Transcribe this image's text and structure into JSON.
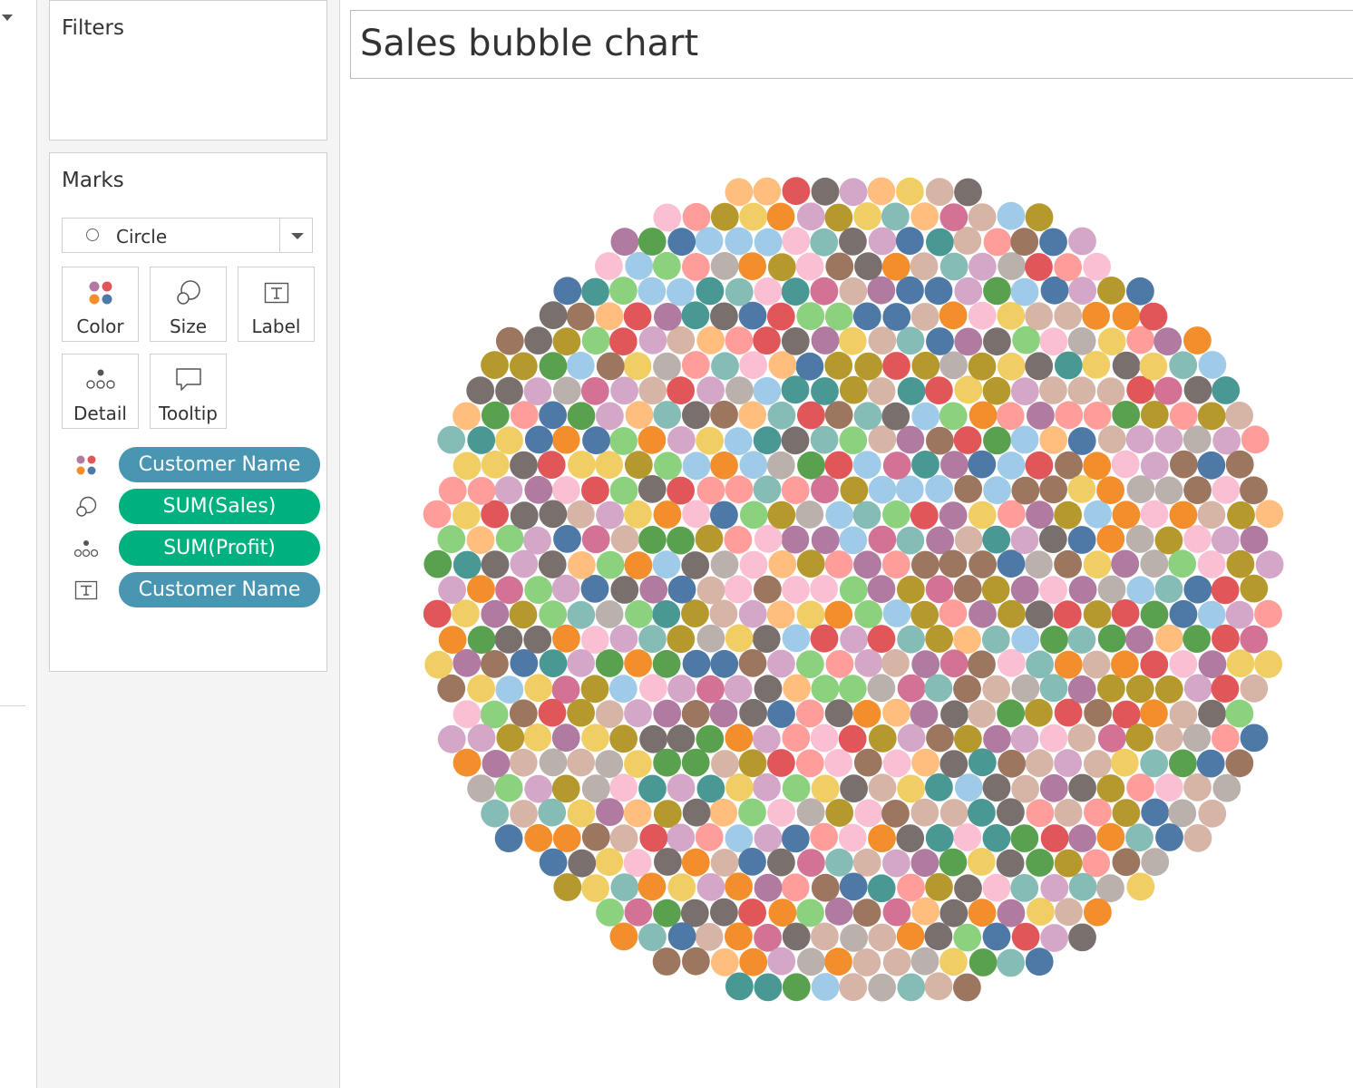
{
  "filters": {
    "title": "Filters"
  },
  "marks": {
    "title": "Marks",
    "mark_type": "Circle",
    "buttons": {
      "color": "Color",
      "size": "Size",
      "label": "Label",
      "detail": "Detail",
      "tooltip": "Tooltip"
    },
    "pills": [
      {
        "encoding": "color",
        "field": "Customer Name"
      },
      {
        "encoding": "size",
        "field": "SUM(Sales)"
      },
      {
        "encoding": "detail",
        "field": "SUM(Profit)"
      },
      {
        "encoding": "label",
        "field": "Customer Name"
      }
    ]
  },
  "viz": {
    "title": "Sales bubble chart"
  },
  "colors": {
    "dimension_pill": "#4996b2",
    "measure_pill": "#00b180",
    "palette": [
      "#4e79a7",
      "#a0cbe8",
      "#f28e2b",
      "#ffbe7d",
      "#59a14f",
      "#8cd17d",
      "#b6992d",
      "#f1ce63",
      "#499894",
      "#86bcb6",
      "#e15759",
      "#ff9d9a",
      "#79706e",
      "#bab0ac",
      "#d37295",
      "#fabfd2",
      "#b07aa1",
      "#d4a6c8",
      "#9d7660",
      "#d7b5a6"
    ]
  },
  "chart_data": {
    "type": "scatter",
    "subtype": "packed-bubble",
    "title": "Sales bubble chart",
    "encodings": {
      "color": "Customer Name",
      "size": "SUM(Sales)",
      "detail": "SUM(Profit)",
      "label": "Customer Name"
    },
    "mark_count": 793,
    "uniform_size": true,
    "layout": "hexagonal-packed-circle",
    "legend": "none",
    "grid": false
  }
}
